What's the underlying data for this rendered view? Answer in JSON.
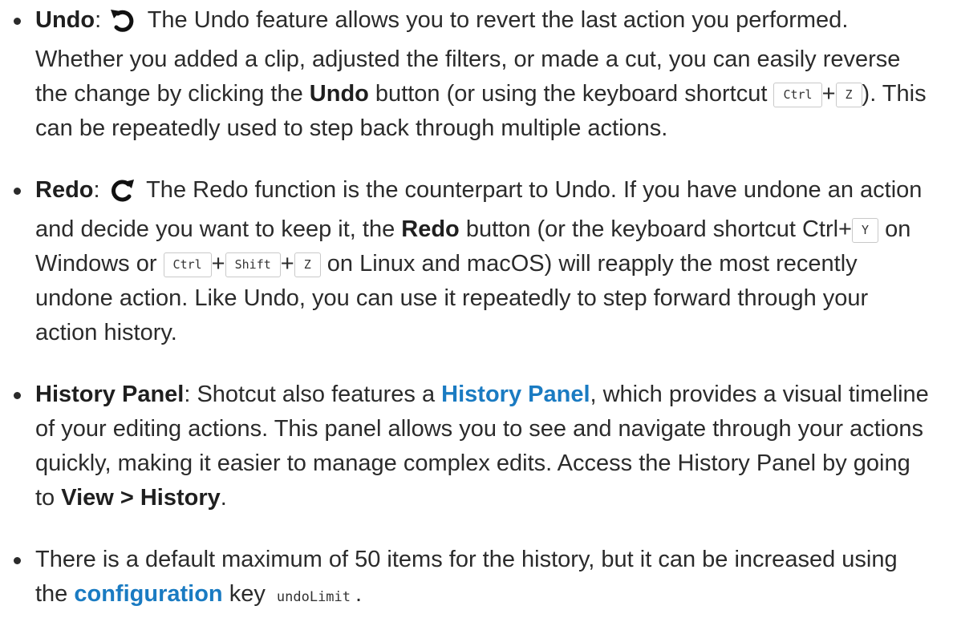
{
  "items": [
    {
      "term": "Undo",
      "icon": "undo-icon",
      "text_1": " The Undo feature allows you to revert the last action you performed. Whether you added a clip, adjusted the filters, or made a cut, you can easily reverse the change by clicking the ",
      "bold_1": "Undo",
      "text_2": " button (or using the keyboard shortcut ",
      "key_ctrl": "Ctrl",
      "plus": "+",
      "key_z": "Z",
      "text_3": "). This can be repeatedly used to step back through multiple actions."
    },
    {
      "term": "Redo",
      "icon": "redo-icon",
      "text_1": " The Redo function is the counterpart to Undo. If you have undone an action and decide you want to keep it, the ",
      "bold_1": "Redo",
      "text_2": " button (or the keyboard shortcut Ctrl+",
      "key_y": "Y",
      "text_3": " on Windows or ",
      "key_ctrl": "Ctrl",
      "plus": "+",
      "key_shift": "Shift",
      "key_z": "Z",
      "text_4": " on Linux and macOS) will reapply the most recently undone action. Like Undo, you can use it repeatedly to step forward through your action history."
    },
    {
      "term": "History Panel",
      "text_1": ": Shotcut also features a ",
      "link": "History Panel",
      "text_2": ", which provides a visual timeline of your editing actions. This panel allows you to see and navigate through your actions quickly, making it easier to manage complex edits. Access the History Panel by going to ",
      "bold_1": "View > History",
      "text_3": "."
    },
    {
      "text_1": "There is a default maximum of 50 items for the history, but it can be increased using the ",
      "link": "configuration",
      "text_2": " key ",
      "code": "undoLimit",
      "text_3": "."
    }
  ],
  "colors": {
    "link": "#1a7bc2",
    "text": "#2b2b2b"
  }
}
